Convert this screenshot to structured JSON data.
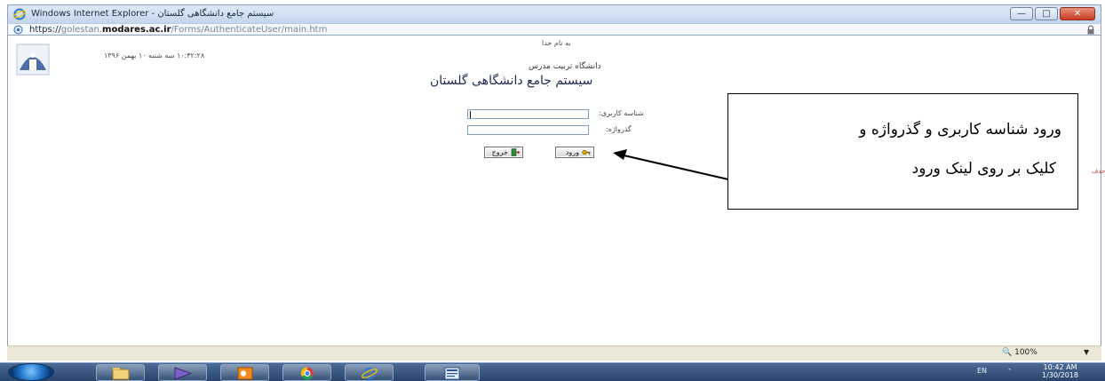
{
  "window": {
    "title": "Windows Internet Explorer - سیستم جامع دانشگاهی گلستان",
    "minimize_glyph": "—",
    "maximize_glyph": "□",
    "close_glyph": "✕"
  },
  "address_bar": {
    "scheme": "https://",
    "subdomain": "golestan.",
    "host": "modares.ac.ir",
    "path": "/Forms/AuthenticateUser/main.htm"
  },
  "page": {
    "bename": "به نام خدا",
    "datetime": "۱۰:۴۲:۲۸ سه شنبه ۱۰ بهمن ۱۳۹۶",
    "university": "دانشگاه تربیت مدرس",
    "system_title": "سیستم جامع دانشگاهی گلستان",
    "username_label": "شناسه کاربری:",
    "password_label": "گذرواژه:",
    "username_value": "",
    "password_value": "",
    "login_button": "ورود",
    "exit_button": "خروج",
    "side_text": "حذف"
  },
  "annotation": {
    "line1": "ورود شناسه کاربری و گذرواژه و",
    "line2": "کلیک بر روی لینک ورود"
  },
  "status": {
    "zoom": "100%"
  },
  "taskbar": {
    "language": "EN",
    "time": "10:42 AM",
    "date": "1/30/2018",
    "items": [
      "explorer",
      "media",
      "outlook",
      "chrome",
      "internet-explorer",
      "word"
    ]
  },
  "colors": {
    "title_bar": "#c4d6ec",
    "taskbar": "#28456d",
    "system_title": "#1e2a56"
  }
}
